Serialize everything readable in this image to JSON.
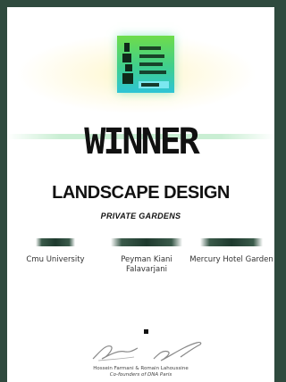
{
  "certificate": {
    "title": "WINNER",
    "category": "LANDSCAPE DESIGN",
    "subcategory": "PRIVATE GARDENS",
    "fields": [
      {
        "value": "Cmu University"
      },
      {
        "value": "Peyman Kiani Falavarjani"
      },
      {
        "value": "Mercury Hotel Garden"
      }
    ],
    "signatories": "Hossein Farmani & Romain Lahoussine",
    "signatories_role": "Co-founders of DNA Paris"
  },
  "colors": {
    "page_background": "#2f4a3e",
    "logo_gradient_top": "#6fdc4a",
    "logo_gradient_bottom": "#2ec4d6",
    "text": "#111111"
  }
}
